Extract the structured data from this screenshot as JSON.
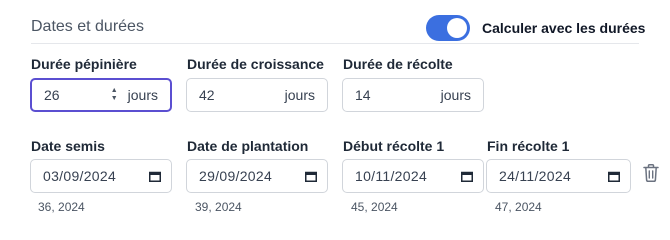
{
  "section": {
    "title": "Dates et durées",
    "toggle_label": "Calculer avec les durées",
    "toggle_on": true
  },
  "durations": [
    {
      "label": "Durée pépinière",
      "value": "26",
      "unit": "jours"
    },
    {
      "label": "Durée de croissance",
      "value": "42",
      "unit": "jours"
    },
    {
      "label": "Durée de récolte",
      "value": "14",
      "unit": "jours"
    }
  ],
  "dates": [
    {
      "label": "Date semis",
      "value": "03/09/2024",
      "week": "36, 2024"
    },
    {
      "label": "Date de plantation",
      "value": "29/09/2024",
      "week": "39, 2024"
    },
    {
      "label": "Début récolte 1",
      "value": "10/11/2024",
      "week": "45, 2024"
    },
    {
      "label": "Fin récolte 1",
      "value": "24/11/2024",
      "week": "47, 2024"
    }
  ],
  "icons": {
    "calendar": "calendar-icon",
    "delete": "trash-icon",
    "spinner": "spinner-arrows-icon"
  },
  "colors": {
    "accent": "#3b6fe0",
    "focus": "#5b4fd1"
  }
}
